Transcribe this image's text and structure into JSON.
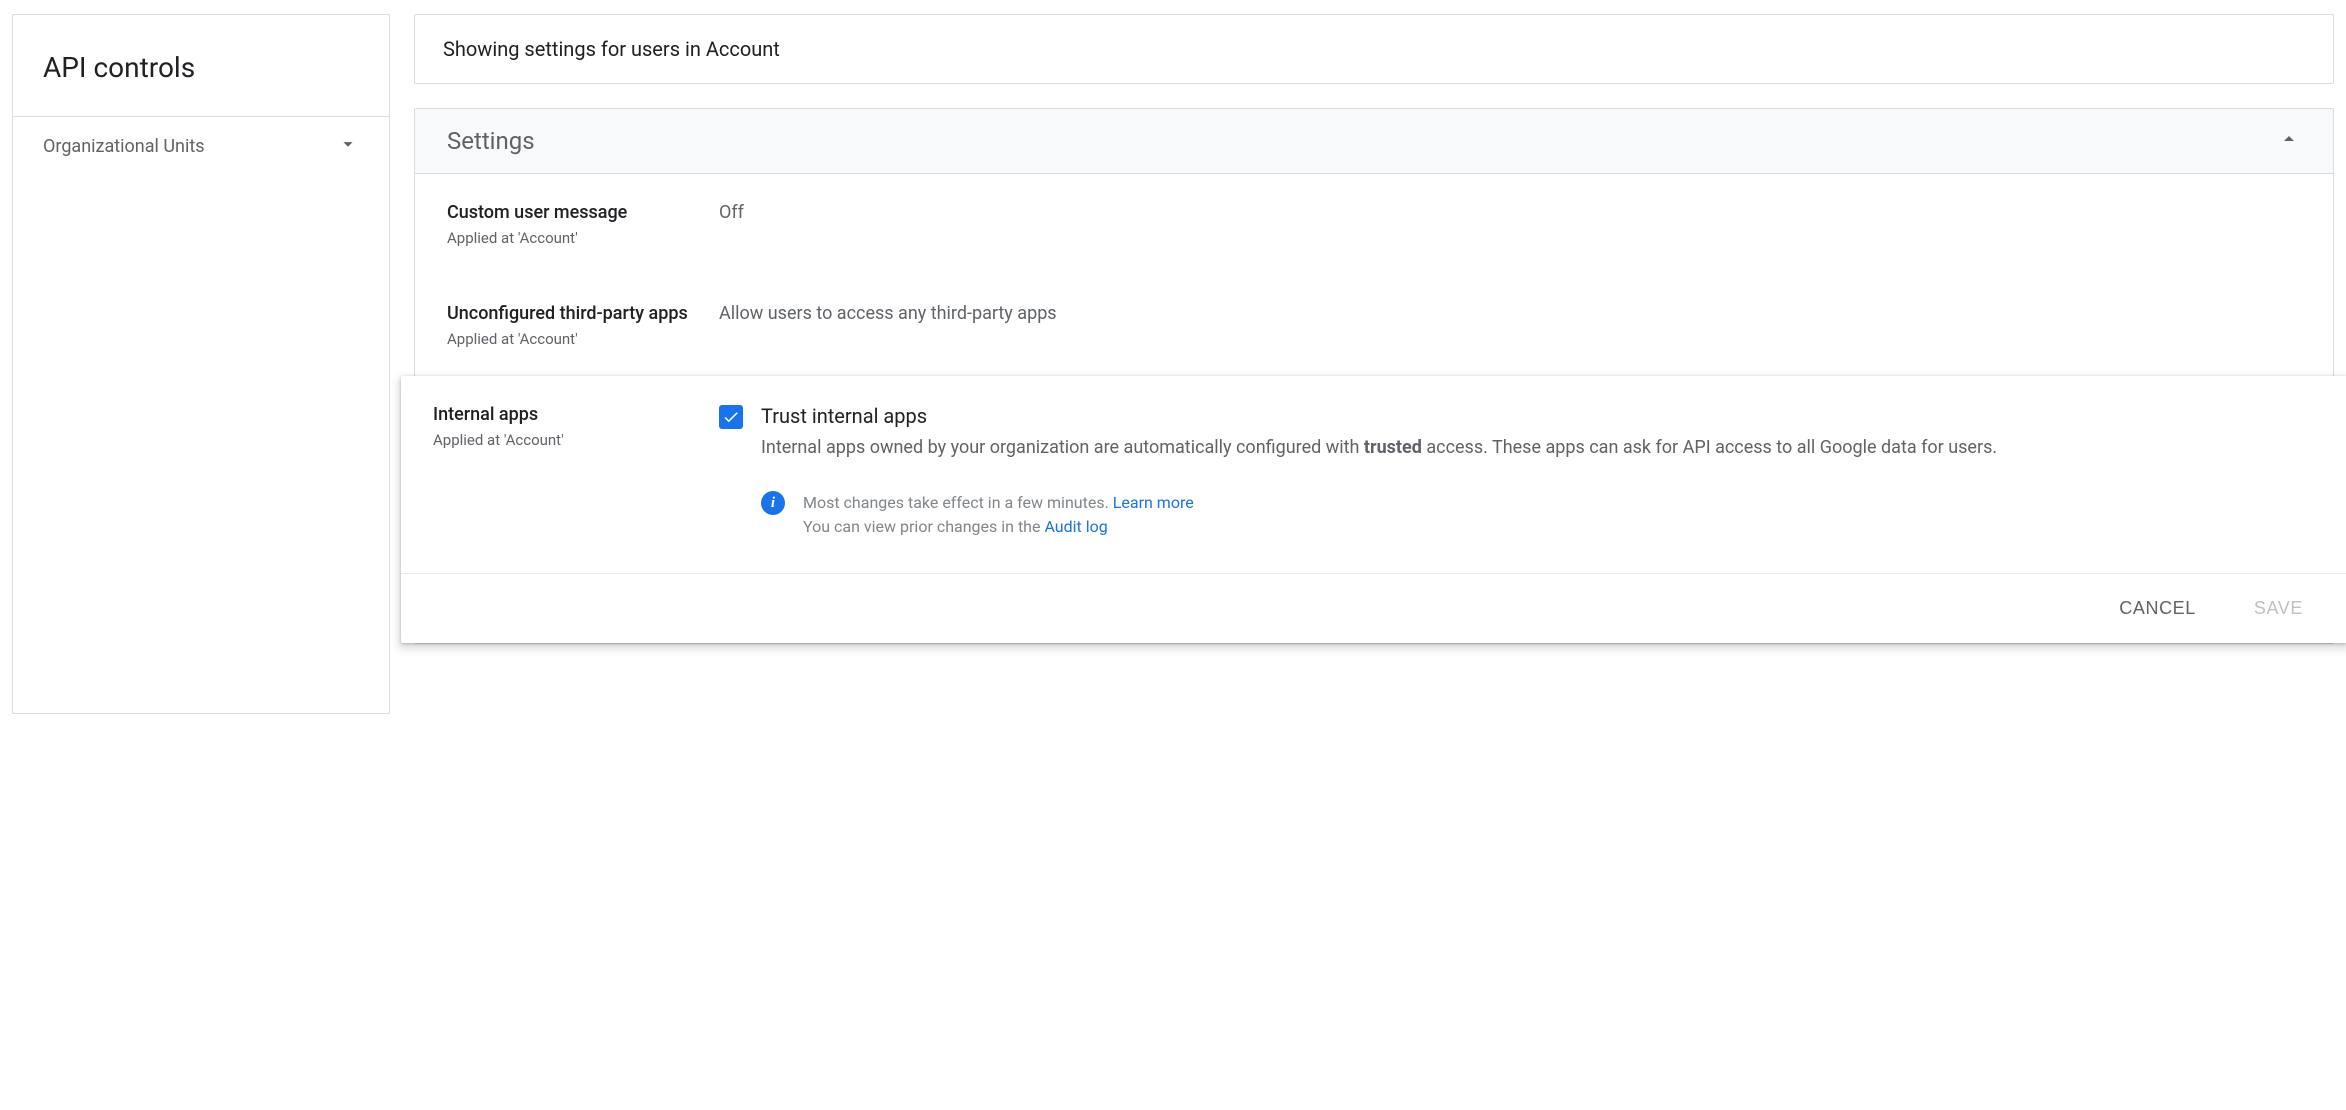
{
  "sidebar": {
    "title": "API controls",
    "org_units_label": "Organizational Units"
  },
  "scope_banner": "Showing settings for users in Account",
  "settings": {
    "header": "Settings",
    "custom_user_message": {
      "name": "Custom user message",
      "applied": "Applied at 'Account'",
      "value": "Off"
    },
    "unconfigured_apps": {
      "name": "Unconfigured third-party apps",
      "applied": "Applied at 'Account'",
      "value": "Allow users to access any third-party apps"
    },
    "internal_apps": {
      "name": "Internal apps",
      "applied": "Applied at 'Account'",
      "checkbox_title": "Trust internal apps",
      "desc_prefix": "Internal apps owned by your organization are automatically configured with ",
      "desc_bold": "trusted",
      "desc_suffix": " access. These apps can ask for API access to all Google data for users.",
      "info_line1_text": "Most changes take effect in a few minutes. ",
      "info_line1_link": "Learn more",
      "info_line2_text": "You can view prior changes in the ",
      "info_line2_link": "Audit log"
    }
  },
  "actions": {
    "cancel": "CANCEL",
    "save": "SAVE"
  }
}
